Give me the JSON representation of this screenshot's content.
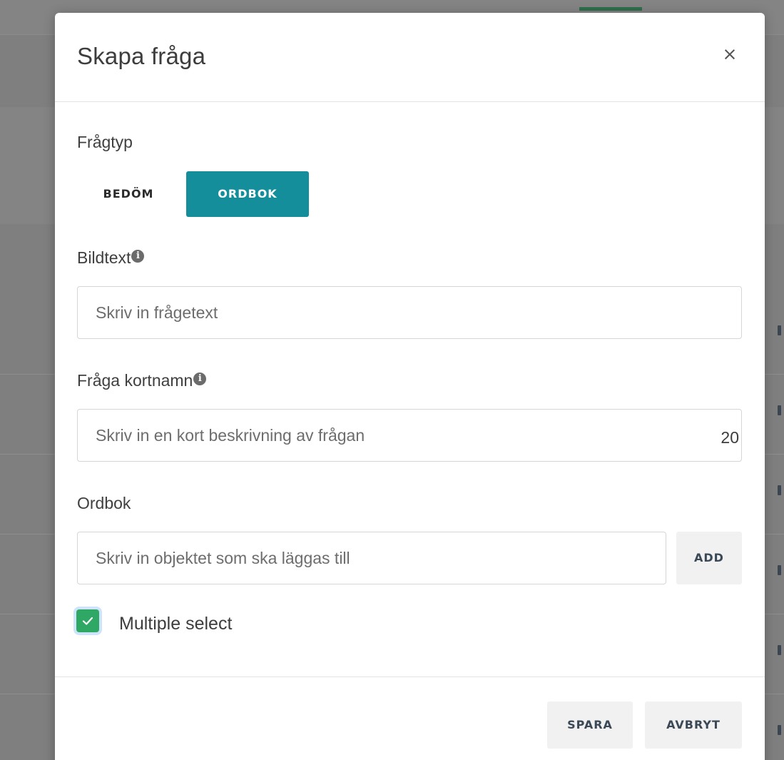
{
  "dialog": {
    "title": "Skapa fråga",
    "close_label": "×"
  },
  "question_type": {
    "label": "Frågtyp",
    "options": [
      {
        "label": "BEDÖM",
        "selected": false
      },
      {
        "label": "ORDBOK",
        "selected": true
      }
    ],
    "active_color": "#148e9b"
  },
  "caption": {
    "label": "Bildtext",
    "info_icon": "info-circle-icon",
    "placeholder": "Skriv in frågetext",
    "value": ""
  },
  "short_name": {
    "label": "Fråga kortnamn",
    "info_icon": "info-circle-icon",
    "placeholder": "Skriv in en kort beskrivning av frågan",
    "value": "",
    "remaining_chars": "20"
  },
  "dictionary": {
    "label": "Ordbok",
    "placeholder": "Skriv in objektet som ska läggas till",
    "value": "",
    "add_label": "ADD"
  },
  "multiple_select": {
    "label": "Multiple select",
    "checked": true,
    "check_color": "#2fa866"
  },
  "footer": {
    "save_label": "SPARA",
    "cancel_label": "AVBRYT"
  }
}
